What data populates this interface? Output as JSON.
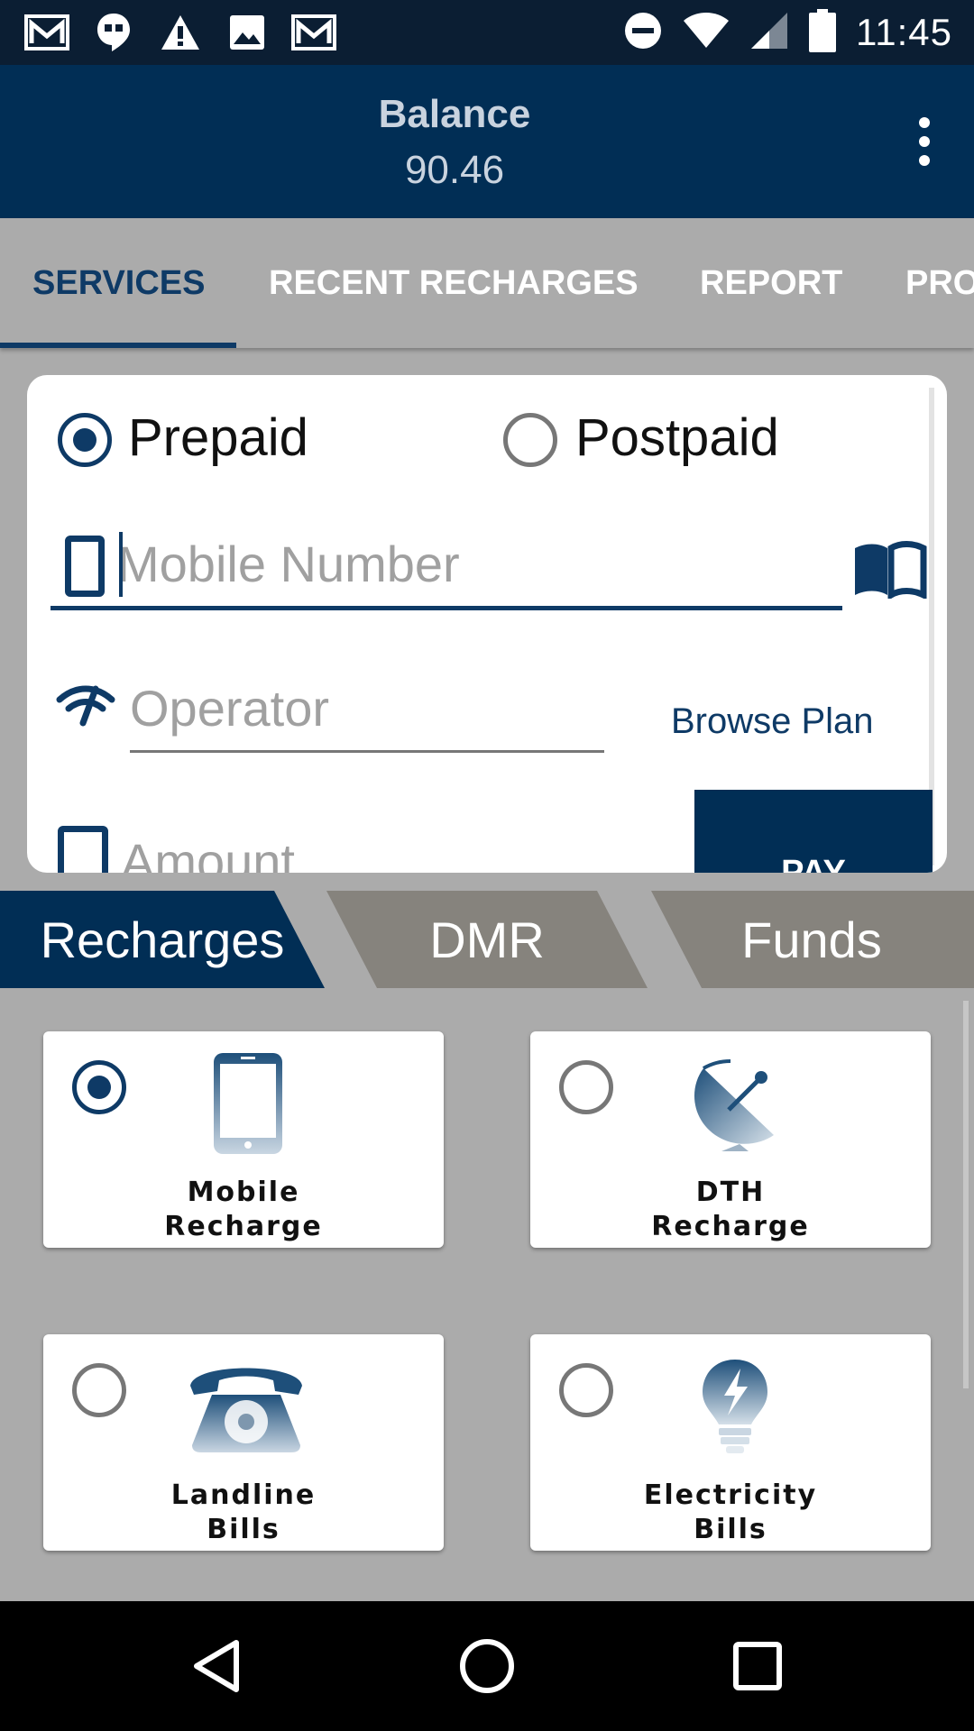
{
  "status_bar": {
    "time": "11:45",
    "left_icons": [
      "gmail-icon",
      "hangouts-icon",
      "alert-icon",
      "image-icon",
      "gmail-icon"
    ],
    "right_icons": [
      "do-not-disturb-icon",
      "wifi-icon",
      "signal-icon",
      "battery-icon"
    ]
  },
  "app_bar": {
    "balance_label": "Balance",
    "balance_value": "90.46"
  },
  "tabs": [
    {
      "label": "SERVICES",
      "active": true
    },
    {
      "label": "RECENT RECHARGES",
      "active": false
    },
    {
      "label": "REPORT",
      "active": false
    },
    {
      "label": "PRO",
      "active": false
    }
  ],
  "form": {
    "plan_types": [
      {
        "label": "Prepaid",
        "selected": true
      },
      {
        "label": "Postpaid",
        "selected": false
      }
    ],
    "mobile_placeholder": "Mobile Number",
    "operator_placeholder": "Operator",
    "browse_plan": "Browse Plan",
    "amount_placeholder": "Amount",
    "pay_label": "PAY"
  },
  "category_tabs": [
    {
      "label": "Recharges",
      "active": true
    },
    {
      "label": "DMR",
      "active": false
    },
    {
      "label": "Funds",
      "active": false
    }
  ],
  "services": [
    {
      "line1": "Mobile",
      "line2": "Recharge",
      "selected": true,
      "icon": "smartphone-icon"
    },
    {
      "line1": "DTH",
      "line2": "Recharge",
      "selected": false,
      "icon": "satellite-dish-icon"
    },
    {
      "line1": "Landline",
      "line2": "Bills",
      "selected": false,
      "icon": "telephone-icon"
    },
    {
      "line1": "Electricity",
      "line2": "Bills",
      "selected": false,
      "icon": "lightbulb-icon"
    }
  ],
  "colors": {
    "primary": "#012e55",
    "status_bar": "#0b1e33",
    "background": "#ababab",
    "inactive_tab": "#86837d"
  }
}
